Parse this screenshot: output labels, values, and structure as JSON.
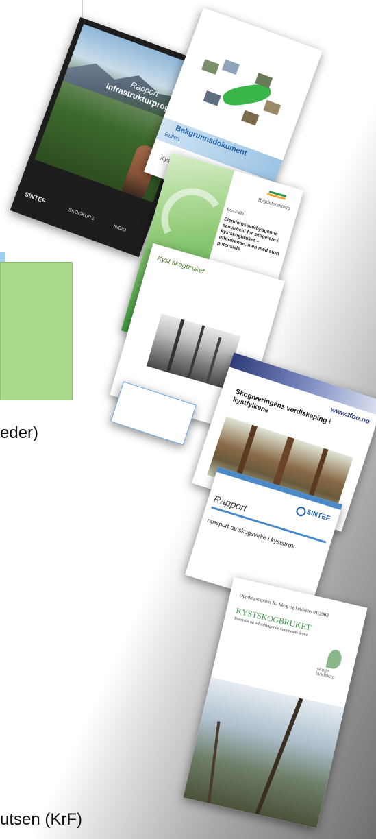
{
  "background": {
    "accent_green": "#a8d88a",
    "accent_blue": "#9fd0f0"
  },
  "fragments": {
    "line1": "eder)",
    "line2": "utsen (KrF)"
  },
  "docs": {
    "rapport_infra": {
      "title1": "Rapport",
      "title2": "Infrastrukturprogrammet",
      "logo1": "SINTEF",
      "logo2": "SKOGKURS",
      "logo3": "NIBIO"
    },
    "bakgrunn": {
      "title": "Bakgrunnsdokument",
      "subtitle": "Rulleri",
      "logo_text": "Kyst skog"
    },
    "bygde": {
      "brand": "Bygdeforskning",
      "author": "Ben Fallo",
      "title": "Eiendomsoverbyggende samarbeid for skogeiere i kystskogbruket – utfordrende, men med stort potensiale"
    },
    "kyst_photo": {
      "logo_text": "Kyst skogbruket"
    },
    "tfou": {
      "url": "www.tfou.no",
      "title": "Skognæringens verdiskaping i kystfylkene"
    },
    "sintef_rapport": {
      "logo": "SINTEF",
      "title": "Rapport",
      "subtitle": "ransport av skogsvirke i kyststrøk"
    },
    "skog_landskap": {
      "header": "Oppdragsrapport fra Skog og landskap 01/2008",
      "title": "KYSTSKOGBRUKET",
      "subtitle": "Potensial og utfordringer de kommende årene",
      "logo": "skog+ landskap"
    }
  }
}
